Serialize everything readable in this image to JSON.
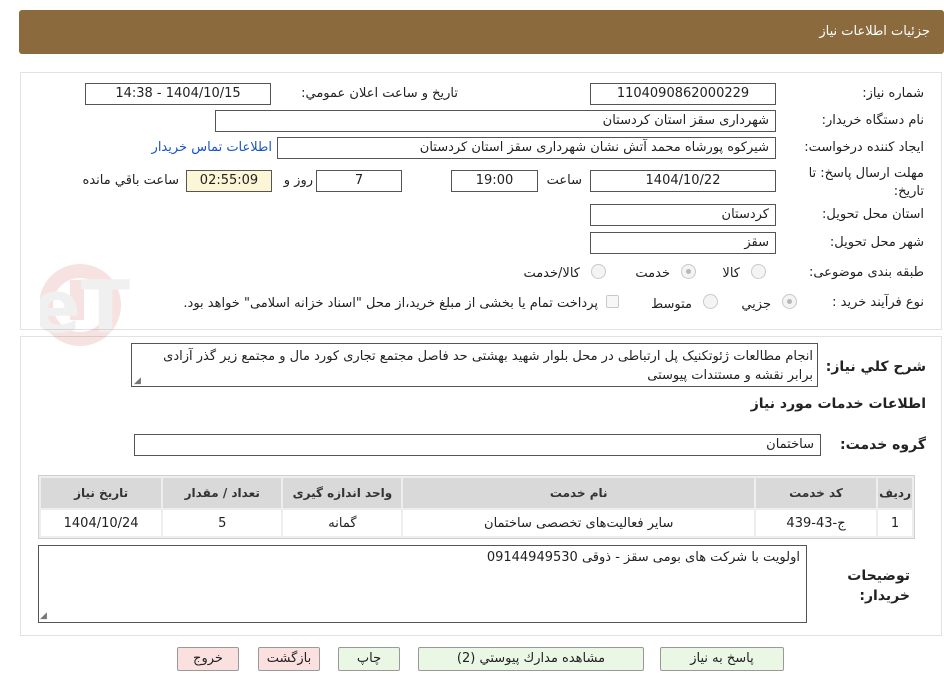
{
  "header": {
    "title": "جزئیات اطلاعات نیاز"
  },
  "form": {
    "need_number_label": "شماره نیاز:",
    "need_number": "1104090862000229",
    "announce_label": "تاریخ و ساعت اعلان عمومي:",
    "announce_value": "1404/10/15 - 14:38",
    "buyer_org_label": "نام دستگاه خريدار:",
    "buyer_org": "شهرداری سقز استان کردستان",
    "requester_label": "ايجاد کننده درخواست:",
    "requester": "شیرکوه پورشاه محمد آتش نشان شهرداری سقز استان کردستان",
    "contact_link": "اطلاعات تماس خريدار",
    "deadline_label": "مهلت ارسال پاسخ: تا تاریخ:",
    "deadline_date": "1404/10/22",
    "time_label": "ساعت",
    "deadline_time": "19:00",
    "days_value": "7",
    "days_label": "روز و",
    "remaining_time": "02:55:09",
    "remaining_label": "ساعت باقي مانده",
    "province_label": "استان محل تحويل:",
    "province": "کردستان",
    "city_label": "شهر محل تحويل:",
    "city": "سقز",
    "category_label": "طبقه بندی موضوعی:",
    "cat_goods": "کالا",
    "cat_service": "خدمت",
    "cat_both": "کالا/خدمت",
    "process_label": "نوع فرآیند خرید :",
    "proc_minor": "جزيي",
    "proc_medium": "متوسط",
    "payment_note": "پرداخت تمام یا بخشی از مبلغ خرید،از محل \"اسناد خزانه اسلامی\" خواهد بود."
  },
  "description": {
    "label": "شرح كلي نياز:",
    "text": "انجام مطالعات ژئوتکنیک پل ارتباطی در محل بلوار شهید بهشتی حد فاصل مجتمع تجاری کورد مال و مجتمع زیر گذر آزادی برابر نقشه و مستندات پیوستی"
  },
  "services": {
    "section_title": "اطلاعات خدمات مورد نياز",
    "group_label": "گروه خدمت:",
    "group_value": "ساختمان",
    "columns": [
      "رديف",
      "کد خدمت",
      "نام خدمت",
      "واحد اندازه گيری",
      "تعداد / مقدار",
      "تاریخ نیاز"
    ],
    "rows": [
      [
        "1",
        "ج-43-439",
        "سایر فعالیت‌های تخصصی ساختمان",
        "گمانه",
        "5",
        "1404/10/24"
      ]
    ]
  },
  "notes": {
    "label": "توضيحات خريدار:",
    "text": "اولویت با شرکت های بومی سقز - ذوقی 09144949530"
  },
  "buttons": {
    "reply": "پاسخ به نياز",
    "docs": "مشاهده مدارك پيوستي (2)",
    "print": "چاپ",
    "back": "بازگشت",
    "exit": "خروج"
  },
  "watermark": "AriaTender.neT",
  "colors": {
    "header_bg": "#8b6a3e",
    "link": "#1a55c8",
    "timer_bg": "#fdf6d6"
  }
}
